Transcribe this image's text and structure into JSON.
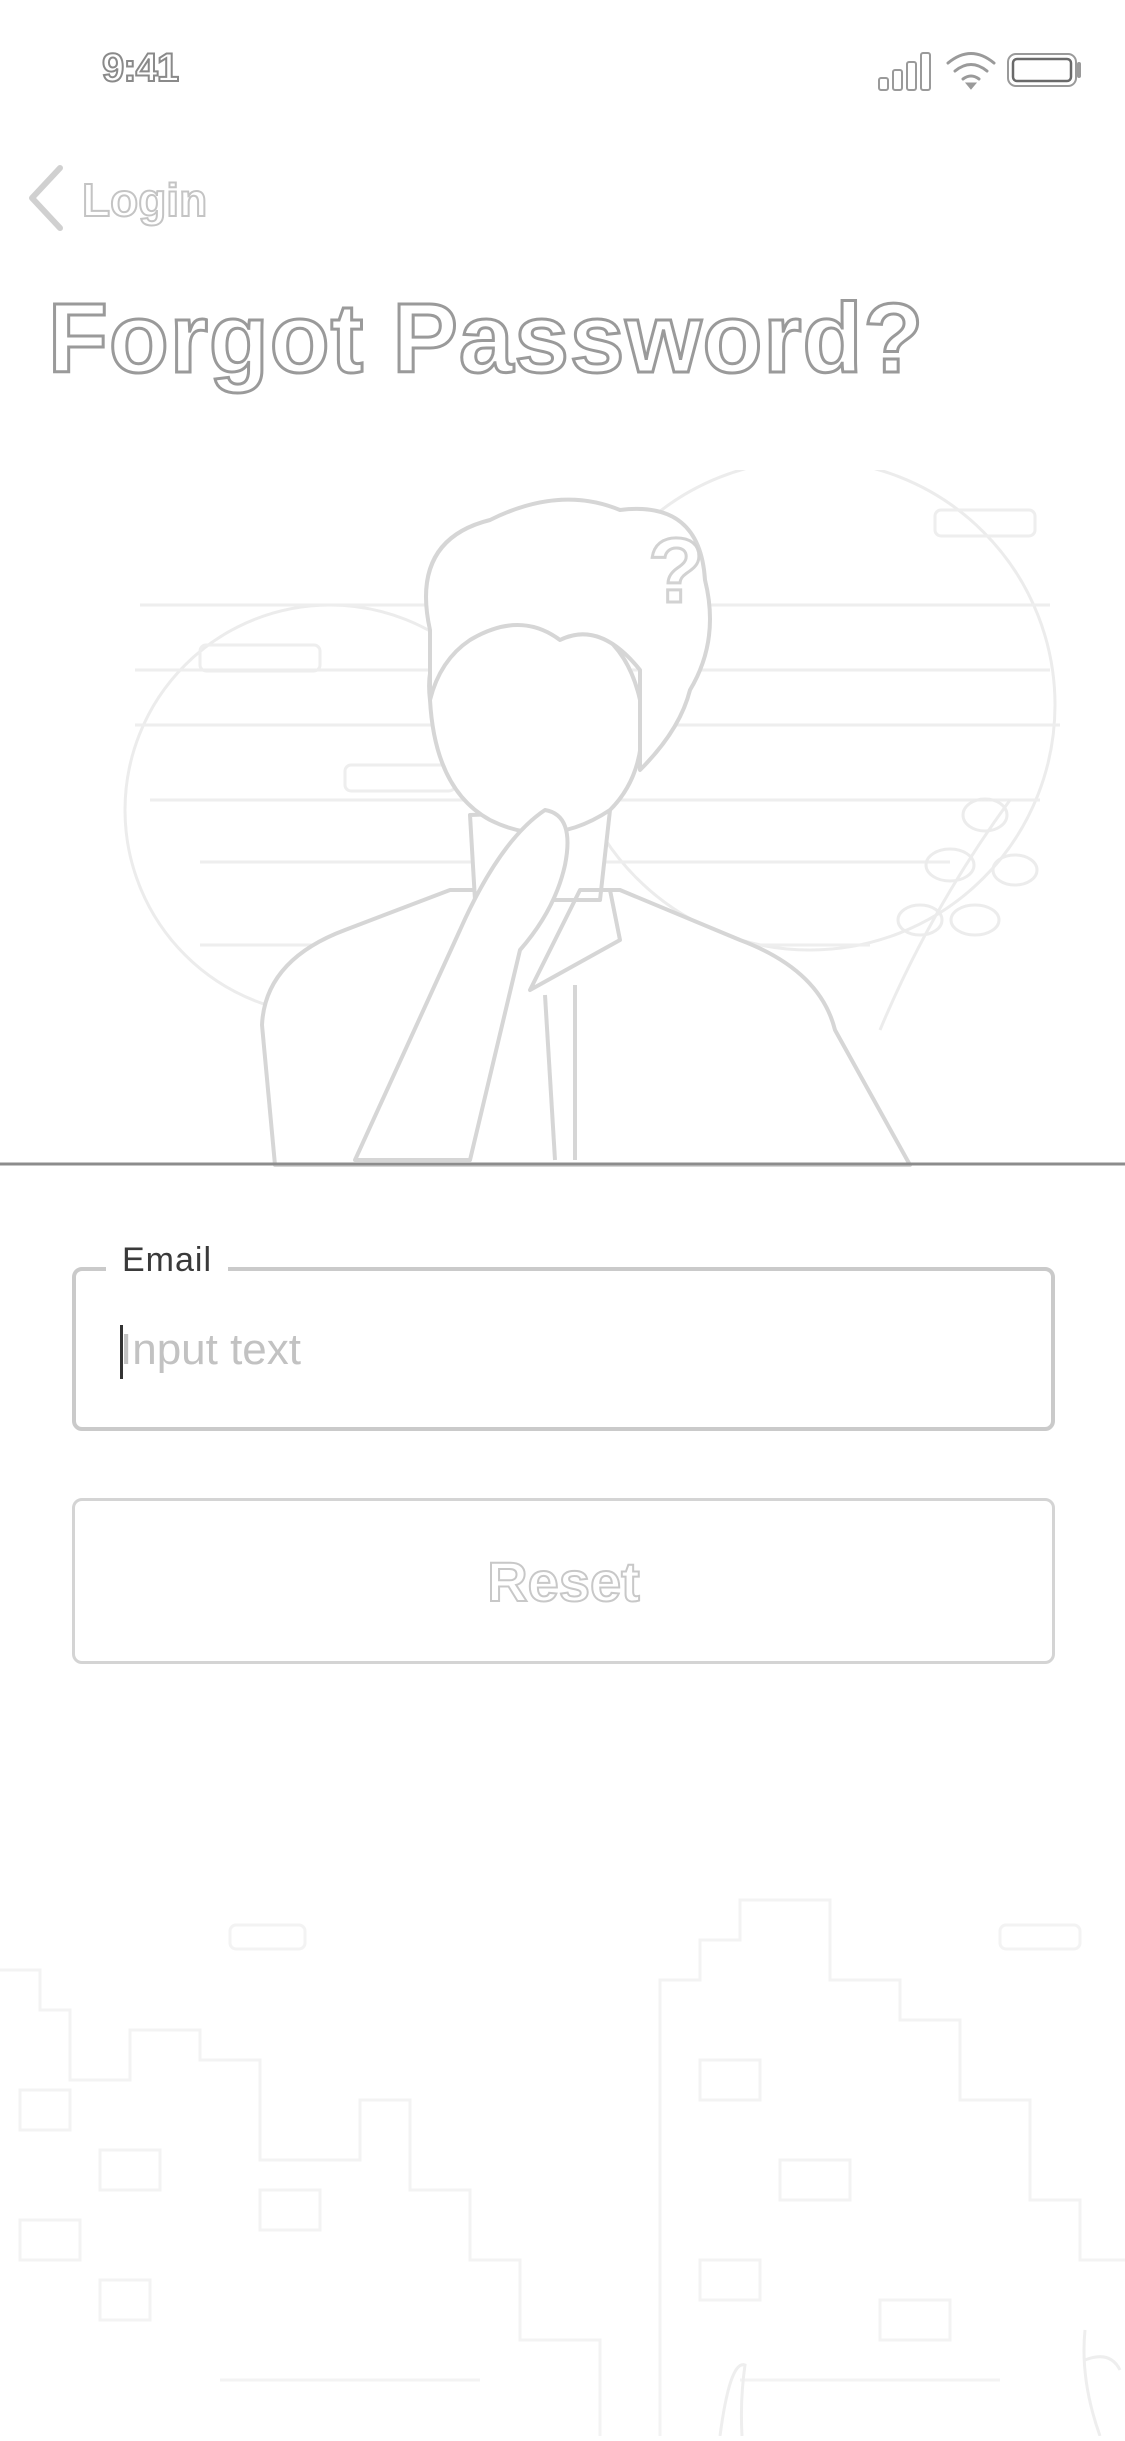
{
  "status_bar": {
    "time": "9:41",
    "icons": [
      "signal-icon",
      "wifi-icon",
      "battery-icon"
    ]
  },
  "nav": {
    "back_label": "Login",
    "back_icon": "chevron-left-icon"
  },
  "page": {
    "title": "Forgot Password?"
  },
  "illustration": {
    "question_mark": "?"
  },
  "form": {
    "email_label": "Email",
    "email_placeholder": "Input text",
    "email_value": "",
    "reset_label": "Reset"
  },
  "colors": {
    "background": "#ffffff",
    "outline": "#9a9a9a",
    "field_border": "#cacaca",
    "placeholder": "#c2c2c2"
  }
}
